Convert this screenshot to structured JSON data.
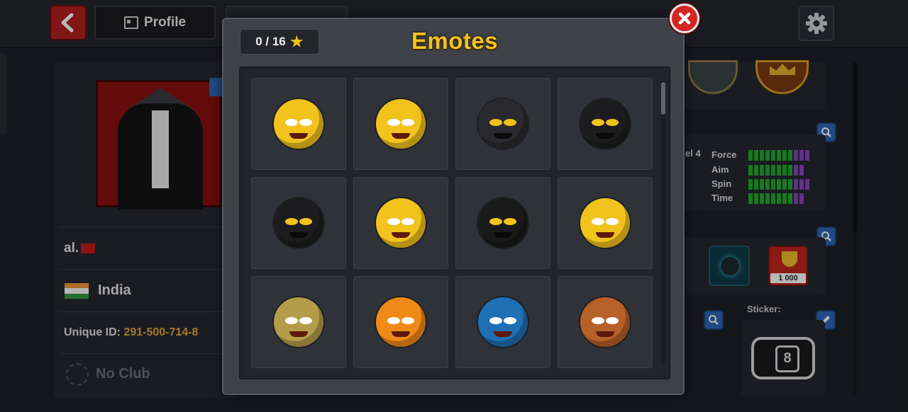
{
  "header": {
    "back_icon": "chevron-left-icon",
    "profile_tab_label": "Profile",
    "settings_icon": "gear-icon"
  },
  "profile": {
    "name": "al.",
    "country": "India",
    "unique_id_label": "Unique ID:",
    "unique_id_value": "291-500-714-8",
    "club": "No Club"
  },
  "stats": {
    "level_fragment": "el 4",
    "rows": [
      {
        "label": "Force",
        "green": 8,
        "purple": 3
      },
      {
        "label": "Aim",
        "green": 8,
        "purple": 2
      },
      {
        "label": "Spin",
        "green": 8,
        "purple": 3
      },
      {
        "label": "Time",
        "green": 8,
        "purple": 2
      }
    ]
  },
  "inventory": {
    "colon_fragment": ":",
    "trophy_amount": "1 000",
    "sticker_label": "Sticker:"
  },
  "modal": {
    "title": "Emotes",
    "counter": "0 / 16",
    "emotes": [
      {
        "name": "goggles-peace-emote",
        "color": "#f2c21d"
      },
      {
        "name": "knight-shield-emote",
        "color": "#f2c21d"
      },
      {
        "name": "black-helmet-emote",
        "color": "#2a2a2e"
      },
      {
        "name": "conical-hat-emote",
        "color": "#1c1c1e"
      },
      {
        "name": "black-ninja-emote",
        "color": "#1c1c1e"
      },
      {
        "name": "masked-ninja-emote",
        "color": "#f2c21d"
      },
      {
        "name": "eight-ball-shuriken-emote",
        "color": "#1a1a1a"
      },
      {
        "name": "laurel-wreath-emote",
        "color": "#f2c21d"
      },
      {
        "name": "hooded-lantern-emote",
        "color": "#b59c4a"
      },
      {
        "name": "champion-belt-emote",
        "color": "#f08a16"
      },
      {
        "name": "luchador-mask-emote",
        "color": "#1f6fb5"
      },
      {
        "name": "angry-headband-emote",
        "color": "#b8602a"
      }
    ]
  }
}
